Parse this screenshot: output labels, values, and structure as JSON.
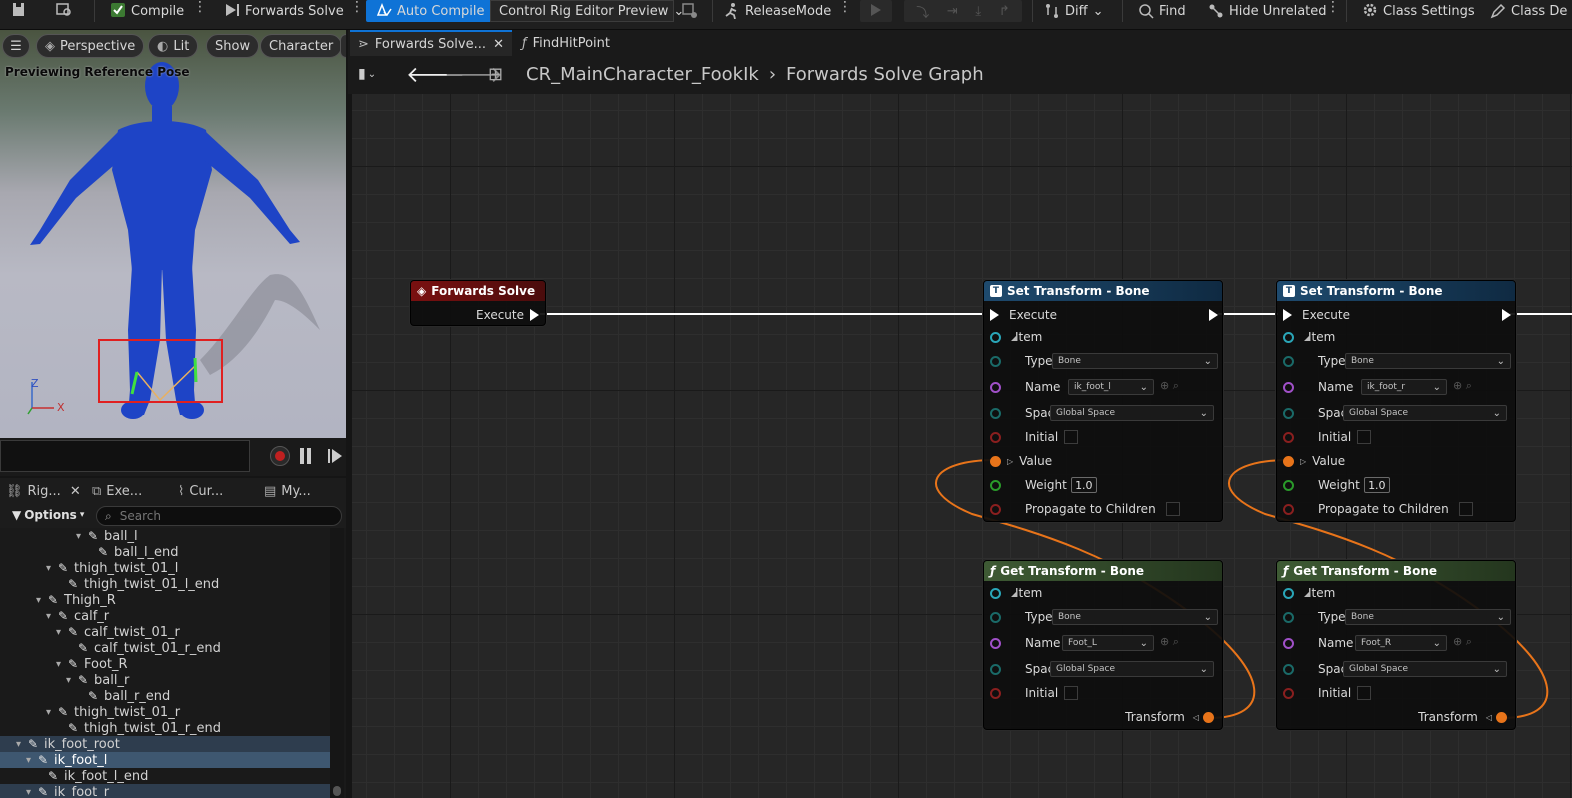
{
  "toolbar": {
    "compile": "Compile",
    "forwards_solve": "Forwards Solve",
    "auto_compile": "Auto Compile",
    "preview": "Control Rig Editor Preview",
    "release_mode": "ReleaseMode",
    "diff": "Diff",
    "find": "Find",
    "hide_unrelated": "Hide Unrelated",
    "class_settings": "Class Settings",
    "class_defaults": "Class De"
  },
  "viewport": {
    "perspective": "Perspective",
    "lit": "Lit",
    "show": "Show",
    "character": "Character",
    "status": "Previewing Reference Pose",
    "axis_z": "Z",
    "axis_x": "X"
  },
  "left_tabs": [
    "Rig...",
    "Exe...",
    "Cur...",
    "My..."
  ],
  "options_label": "Options",
  "search_placeholder": "Search",
  "tree": [
    {
      "label": "ball_l",
      "indent": 7
    },
    {
      "label": "ball_l_end",
      "indent": 8
    },
    {
      "label": "thigh_twist_01_l",
      "indent": 4
    },
    {
      "label": "thigh_twist_01_l_end",
      "indent": 5
    },
    {
      "label": "Thigh_R",
      "indent": 3
    },
    {
      "label": "calf_r",
      "indent": 4
    },
    {
      "label": "calf_twist_01_r",
      "indent": 5
    },
    {
      "label": "calf_twist_01_r_end",
      "indent": 6
    },
    {
      "label": "Foot_R",
      "indent": 5
    },
    {
      "label": "ball_r",
      "indent": 6
    },
    {
      "label": "ball_r_end",
      "indent": 7
    },
    {
      "label": "thigh_twist_01_r",
      "indent": 4
    },
    {
      "label": "thigh_twist_01_r_end",
      "indent": 5
    },
    {
      "label": "ik_foot_root",
      "indent": 1
    },
    {
      "label": "ik_foot_l",
      "indent": 2
    },
    {
      "label": "ik_foot_l_end",
      "indent": 3
    },
    {
      "label": "ik_foot_r",
      "indent": 2
    }
  ],
  "graph_tabs": {
    "active": "Forwards Solve...",
    "other": "FindHitPoint"
  },
  "breadcrumb": {
    "asset": "CR_MainCharacter_FookIk",
    "graph": "Forwards Solve Graph"
  },
  "nodes": {
    "forwards_solve": {
      "title": "Forwards Solve",
      "execute": "Execute"
    },
    "set_labels": {
      "title": "Set Transform - Bone",
      "execute": "Execute",
      "item": "Item",
      "type": "Type",
      "name": "Name",
      "space": "Space",
      "initial": "Initial",
      "value": "Value",
      "weight": "Weight",
      "propagate": "Propagate to Children",
      "type_value": "Bone",
      "space_value": "Global Space",
      "weight_value": "1.0"
    },
    "set_1_name": "ik_foot_l",
    "set_2_name": "ik_foot_r",
    "get_labels": {
      "title": "Get Transform - Bone",
      "item": "Item",
      "type": "Type",
      "name": "Name",
      "space": "Space",
      "initial": "Initial",
      "transform": "Transform",
      "type_value": "Bone",
      "space_value": "Global Space"
    },
    "get_1_name": "Foot_L",
    "get_2_name": "Foot_R"
  },
  "colors": {
    "accent": "#0f73d6",
    "wire_exec": "#ffffff",
    "wire_transform": "#e8741a",
    "highlight_box": "#e02020"
  }
}
